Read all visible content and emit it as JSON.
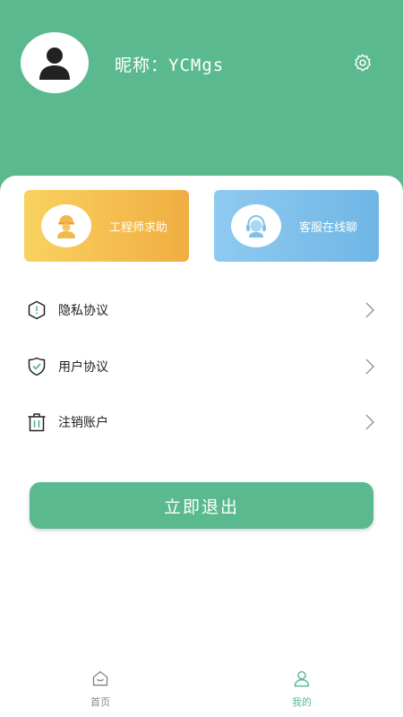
{
  "header": {
    "nickname": "昵称：YCMgs",
    "avatar_icon": "user-avatar-icon",
    "settings_icon": "gear-icon"
  },
  "quick_actions": [
    {
      "label": "工程师求助",
      "icon": "engineer-icon"
    },
    {
      "label": "客服在线聊",
      "icon": "customer-service-icon"
    }
  ],
  "menu": [
    {
      "label": "隐私协议",
      "icon": "shield-alert-icon"
    },
    {
      "label": "用户协议",
      "icon": "shield-check-icon"
    },
    {
      "label": "注销账户",
      "icon": "trash-icon"
    }
  ],
  "logout_label": "立即退出",
  "tabbar": [
    {
      "label": "首页",
      "icon": "home-icon",
      "active": false
    },
    {
      "label": "我的",
      "icon": "user-icon",
      "active": true
    }
  ],
  "colors": {
    "primary": "#5bb98f",
    "engineer_card": "#f3b84b",
    "service_card": "#7fc0ea"
  }
}
